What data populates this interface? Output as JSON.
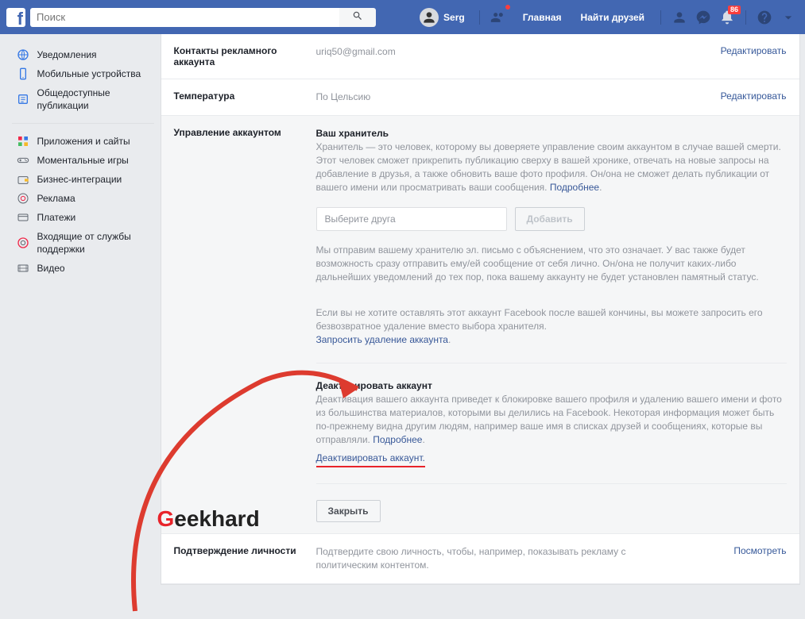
{
  "topbar": {
    "search_placeholder": "Поиск",
    "user_name": "Serg",
    "nav_home": "Главная",
    "nav_find_friends": "Найти друзей",
    "badge_count": "86"
  },
  "sidebar": {
    "group1": [
      {
        "label": "Уведомления"
      },
      {
        "label": "Мобильные устройства"
      },
      {
        "label": "Общедоступные публикации"
      }
    ],
    "group2": [
      {
        "label": "Приложения и сайты"
      },
      {
        "label": "Моментальные игры"
      },
      {
        "label": "Бизнес-интеграции"
      },
      {
        "label": "Реклама"
      },
      {
        "label": "Платежи"
      },
      {
        "label": "Входящие от службы поддержки"
      },
      {
        "label": "Видео"
      }
    ]
  },
  "rows": {
    "contacts": {
      "label": "Контакты рекламного аккаунта",
      "value": "uriq50@gmail.com",
      "action": "Редактировать"
    },
    "temperature": {
      "label": "Температура",
      "value": "По Цельсию",
      "action": "Редактировать"
    },
    "manage": {
      "label": "Управление аккаунтом"
    },
    "identity": {
      "label": "Подтверждение личности",
      "value": "Подтвердите свою личность, чтобы, например, показывать рекламу с политическим контентом.",
      "action": "Посмотреть"
    }
  },
  "legacy": {
    "title": "Ваш хранитель",
    "desc": "Хранитель — это человек, которому вы доверяете управление своим аккаунтом в случае вашей смерти. Этот человек сможет прикрепить публикацию сверху в вашей хронике, отвечать на новые запросы на добавление в друзья, а также обновить ваше фото профиля. Он/она не сможет делать публикации от вашего имени или просматривать ваши сообщения. ",
    "learn_more": "Подробнее",
    "friend_placeholder": "Выберите друга",
    "add_btn": "Добавить",
    "email_note": "Мы отправим вашему хранителю эл. письмо с объяснением, что это означает. У вас также будет возможность сразу отправить ему/ей сообщение от себя лично. Он/она не получит каких-либо дальнейших уведомлений до тех пор, пока вашему аккаунту не будет установлен памятный статус.",
    "delete_note": "Если вы не хотите оставлять этот аккаунт Facebook после вашей кончины, вы можете запросить его безвозвратное удаление вместо выбора хранителя.",
    "request_delete": "Запросить удаление аккаунта"
  },
  "deactivate": {
    "title": "Деактивировать аккаунт",
    "desc": "Деактивация вашего аккаунта приведет к блокировке вашего профиля и удалению вашего имени и фото из большинства материалов, которыми вы делились на Facebook. Некоторая информация может быть по-прежнему видна другим людям, например ваше имя в списках друзей и сообщениях, которые вы отправляли. ",
    "learn_more": "Подробнее",
    "link": "Деактивировать аккаунт"
  },
  "close_btn": "Закрыть",
  "watermark": "eekhard"
}
